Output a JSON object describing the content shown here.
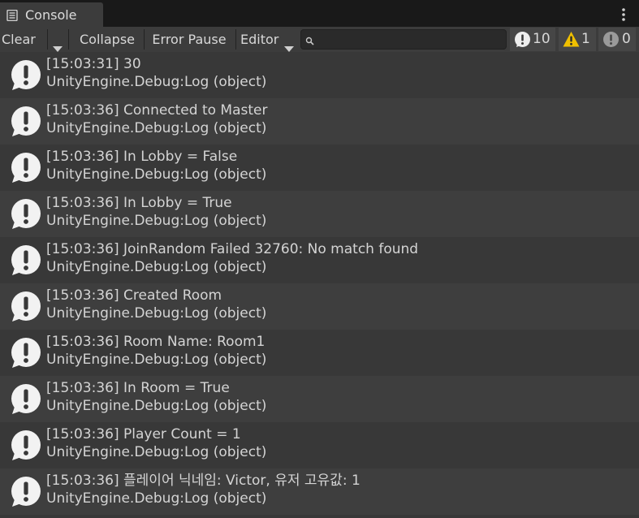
{
  "tab": {
    "title": "Console",
    "icon": "console-list-icon",
    "menu_icon": "kebab-menu-icon"
  },
  "toolbar": {
    "clear_label": "Clear",
    "clear_dropdown_icon": "chevron-down-icon",
    "collapse_label": "Collapse",
    "error_pause_label": "Error Pause",
    "editor_label": "Editor",
    "search_placeholder": "",
    "search_value": "",
    "counters": {
      "log": "10",
      "warning": "1",
      "error": "0"
    }
  },
  "colors": {
    "background": "#383838",
    "row_alt": "#3e3e3e",
    "warning": "#f0c000",
    "icon_white": "#f2f2f2"
  },
  "logs": [
    {
      "message": "[15:03:31] 30",
      "trace": "UnityEngine.Debug:Log (object)"
    },
    {
      "message": "[15:03:36] Connected to Master",
      "trace": "UnityEngine.Debug:Log (object)"
    },
    {
      "message": "[15:03:36] In Lobby = False",
      "trace": "UnityEngine.Debug:Log (object)"
    },
    {
      "message": "[15:03:36] In Lobby = True",
      "trace": "UnityEngine.Debug:Log (object)"
    },
    {
      "message": "[15:03:36] JoinRandom Failed 32760: No match found",
      "trace": "UnityEngine.Debug:Log (object)"
    },
    {
      "message": "[15:03:36] Created Room",
      "trace": "UnityEngine.Debug:Log (object)"
    },
    {
      "message": "[15:03:36] Room Name: Room1",
      "trace": "UnityEngine.Debug:Log (object)"
    },
    {
      "message": "[15:03:36] In Room = True",
      "trace": "UnityEngine.Debug:Log (object)"
    },
    {
      "message": "[15:03:36] Player Count = 1",
      "trace": "UnityEngine.Debug:Log (object)"
    },
    {
      "message": "[15:03:36] 플레이어 닉네임: Victor, 유저 고유값: 1",
      "trace": "UnityEngine.Debug:Log (object)"
    }
  ]
}
